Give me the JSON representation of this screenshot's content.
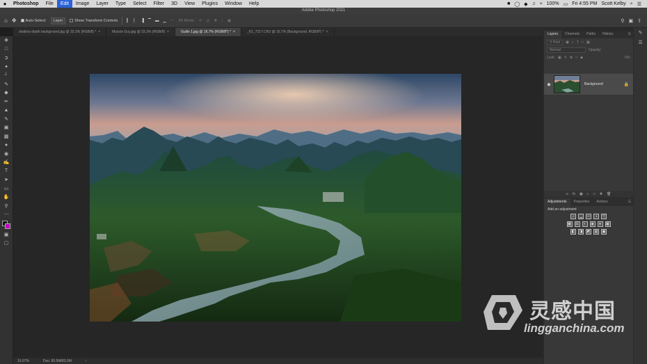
{
  "menubar": {
    "apple": "",
    "items": [
      "Photoshop",
      "File",
      "Edit",
      "Image",
      "Layer",
      "Type",
      "Select",
      "Filter",
      "3D",
      "View",
      "Plugins",
      "Window",
      "Help"
    ],
    "active_index": 2,
    "battery": "100%",
    "datetime": "Fri 4:55 PM",
    "user": "Scott Kelby"
  },
  "window": {
    "title": "Adobe Photoshop 2021"
  },
  "options": {
    "auto_select_label": "Auto-Select:",
    "auto_select_value": "Layer",
    "transform_label": "Show Transform Controls",
    "mode_label": "3D Mode:"
  },
  "tabs": [
    {
      "label": "shallow depth background.jpg @ 33.3% (RGB/8) *"
    },
    {
      "label": "Muscle Guy.jpg @ 33.3% (RGB/8)"
    },
    {
      "label": "Guilin 1.jpg @ 16.7% (RGB/8*) *"
    },
    {
      "label": "_K2_7317.CR2 @ 16.7% (Background, RGB/8*) *"
    }
  ],
  "active_tab": 2,
  "status": {
    "zoom": "16.67%",
    "doc": "Doc: 83.5M/83.5M"
  },
  "layers_panel": {
    "tabs": [
      "Layers",
      "Channels",
      "Paths",
      "History"
    ],
    "filter_kind": "Kind",
    "blend_mode": "Normal",
    "opacity_label": "Opacity:",
    "lock_label": "Lock:",
    "fill_label": "Fill:",
    "layer_name": "Background"
  },
  "adjustments_panel": {
    "tabs": [
      "Adjustments",
      "Properties",
      "Actions"
    ],
    "add_label": "Add an adjustment"
  },
  "watermark": {
    "cn": "灵感中国",
    "en": "lingganchina.com"
  },
  "colors": {
    "foreground": "#111111",
    "background": "#c000c0",
    "accent": "#2a62d9"
  }
}
